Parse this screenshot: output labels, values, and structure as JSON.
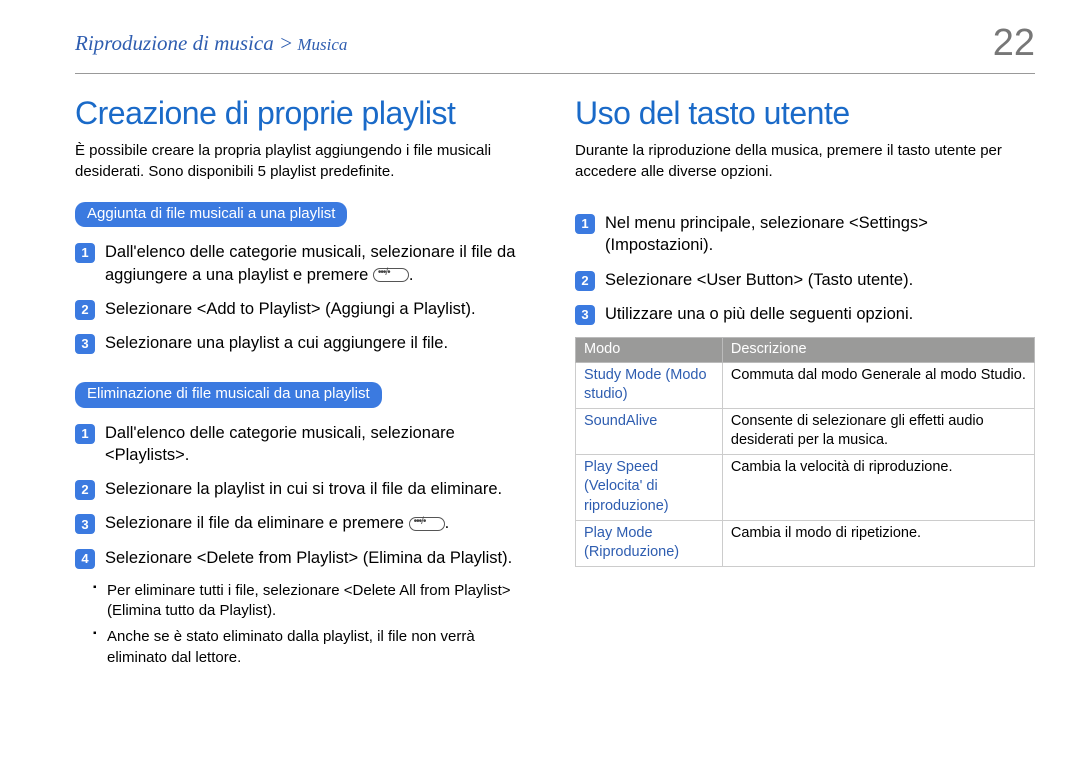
{
  "header": {
    "breadcrumb_main": "Riproduzione di musica >",
    "breadcrumb_sub": " Musica",
    "page_number": "22"
  },
  "left": {
    "title": "Creazione di proprie playlist",
    "intro": "È possibile creare la propria playlist aggiungendo i file musicali desiderati. Sono disponibili 5 playlist predefinite.",
    "section_a": {
      "pill": "Aggiunta di file musicali a una playlist",
      "steps": [
        "Dall'elenco delle categorie musicali, selezionare il file da aggiungere a una playlist e premere ",
        "Selezionare <Add to Playlist> (Aggiungi a Playlist).",
        "Selezionare una playlist a cui aggiungere il file."
      ]
    },
    "section_b": {
      "pill": "Eliminazione di file musicali da una playlist",
      "steps": [
        "Dall'elenco delle categorie musicali, selezionare <Playlists>.",
        "Selezionare la playlist in cui si trova il file da eliminare.",
        "Selezionare il file da eliminare e premere ",
        "Selezionare <Delete from Playlist> (Elimina da Playlist)."
      ],
      "bullets": [
        "Per eliminare tutti i file, selezionare <Delete All from Playlist> (Elimina tutto da Playlist).",
        "Anche se è stato eliminato dalla playlist, il file non verrà eliminato dal lettore."
      ]
    }
  },
  "right": {
    "title": "Uso del tasto utente",
    "intro": "Durante la riproduzione della musica, premere il tasto utente per accedere alle diverse opzioni.",
    "steps": [
      "Nel menu principale, selezionare <Settings> (Impostazioni).",
      "Selezionare <User Button> (Tasto utente).",
      "Utilizzare una o più delle seguenti opzioni."
    ],
    "table": {
      "headers": [
        "Modo",
        "Descrizione"
      ],
      "rows": [
        {
          "mode": "Study Mode (Modo studio)",
          "desc": "Commuta dal modo Generale al modo Studio."
        },
        {
          "mode": "SoundAlive",
          "desc": "Consente di selezionare gli effetti audio desiderati per la musica."
        },
        {
          "mode": "Play Speed (Velocita' di riproduzione)",
          "desc": "Cambia la velocità di riproduzione."
        },
        {
          "mode": "Play Mode (Riproduzione)",
          "desc": "Cambia il modo di ripetizione."
        }
      ]
    }
  }
}
